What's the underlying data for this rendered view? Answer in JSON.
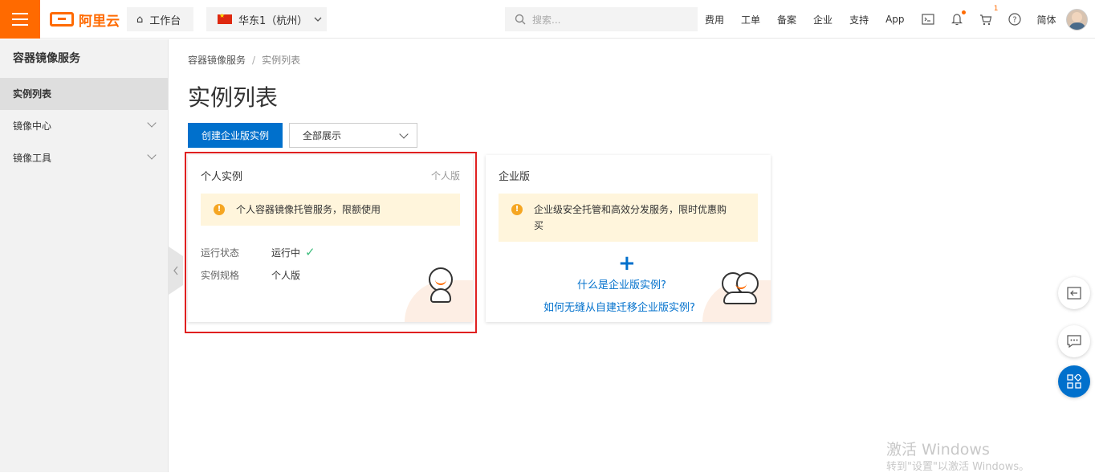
{
  "topbar": {
    "logo_text": "阿里云",
    "workbench": "工作台",
    "region": "华东1（杭州）",
    "search_placeholder": "搜索...",
    "nav": [
      "费用",
      "工单",
      "备案",
      "企业",
      "支持",
      "App"
    ],
    "cart_count": "1",
    "language": "简体"
  },
  "sidebar": {
    "title": "容器镜像服务",
    "items": [
      {
        "label": "实例列表"
      },
      {
        "label": "镜像中心"
      },
      {
        "label": "镜像工具"
      }
    ]
  },
  "breadcrumb": {
    "root": "容器镜像服务",
    "sep": "/",
    "current": "实例列表"
  },
  "page": {
    "title": "实例列表",
    "create_button": "创建企业版实例",
    "filter_value": "全部展示"
  },
  "personal_card": {
    "title": "个人实例",
    "tag": "个人版",
    "notice": "个人容器镜像托管服务，限额使用",
    "status_label": "运行状态",
    "status_value": "运行中",
    "spec_label": "实例规格",
    "spec_value": "个人版"
  },
  "enterprise_card": {
    "title": "企业版",
    "notice": "企业级安全托管和高效分发服务，限时优惠购买",
    "link1": "什么是企业版实例?",
    "link2": "如何无缝从自建迁移企业版实例?"
  },
  "watermark": {
    "line1": "激活 Windows",
    "line2": "转到\"设置\"以激活 Windows。"
  },
  "colors": {
    "brand": "#ff6a00",
    "primary": "#0070cc",
    "success": "#3dbd7d",
    "highlight_border": "#e02020"
  }
}
